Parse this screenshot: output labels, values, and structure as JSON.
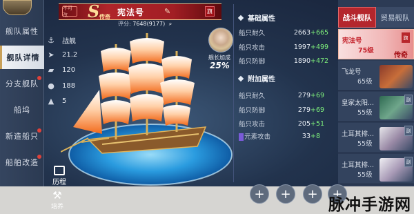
{
  "colors": {
    "accent_red": "#b4262c",
    "bonus_green": "#7ef07c",
    "bg_dark": "#1f2d45"
  },
  "nav": {
    "items": [
      {
        "label": "舰队属性",
        "active": false,
        "dot": false
      },
      {
        "label": "舰队详情",
        "active": true,
        "dot": false
      },
      {
        "label": "分支舰队",
        "active": false,
        "dot": true
      },
      {
        "label": "船坞",
        "active": false,
        "dot": false
      },
      {
        "label": "新造船只",
        "active": false,
        "dot": true
      },
      {
        "label": "船舶改造",
        "active": false,
        "dot": true
      }
    ],
    "history_label": "历程"
  },
  "ship_stats": [
    {
      "icon": "warship-icon",
      "value": "战舰"
    },
    {
      "icon": "speed-icon",
      "value": "21.2"
    },
    {
      "icon": "cannon-icon",
      "value": "120"
    },
    {
      "icon": "crew-icon",
      "value": "188"
    },
    {
      "icon": "cargo-icon",
      "value": "5"
    }
  ],
  "ship": {
    "grade": "S",
    "grade_label": "传奇",
    "name": "宪法号",
    "rating_label": "评分:",
    "rating_value": "7648(9177)",
    "left_stamp": "不可改",
    "right_stamp": "旗"
  },
  "captain": {
    "label": "舰长加成",
    "bonus": "25%"
  },
  "base_attrs": {
    "title": "基础属性",
    "rows": [
      {
        "name": "船只耐久",
        "base": "2663",
        "bonus": "+665"
      },
      {
        "name": "船只攻击",
        "base": "1997",
        "bonus": "+499"
      },
      {
        "name": "船只防御",
        "base": "1890",
        "bonus": "+472"
      }
    ]
  },
  "extra_attrs": {
    "title": "附加属性",
    "rows": [
      {
        "name": "船只耐久",
        "base": "279",
        "bonus": "+69"
      },
      {
        "name": "船只防御",
        "base": "279",
        "bonus": "+69"
      },
      {
        "name": "船只攻击",
        "base": "205",
        "bonus": "+51"
      },
      {
        "name": "元素攻击",
        "base": "33",
        "bonus": "+8"
      }
    ]
  },
  "slots": [
    "+",
    "+",
    "+",
    "+"
  ],
  "fleet_tabs": [
    {
      "label": "战斗舰队",
      "active": true
    },
    {
      "label": "贸易舰队",
      "active": false
    }
  ],
  "fleet_cards": [
    {
      "name": "宪法号",
      "level": "75级",
      "tag": "旗",
      "legend": "传奇",
      "active": true
    },
    {
      "name": "飞龙号",
      "level": "65级",
      "active": false
    },
    {
      "name": "皇家太阳...",
      "level": "55级",
      "tag": "副",
      "active": false
    },
    {
      "name": "土耳其排...",
      "level": "55级",
      "tag": "副",
      "active": false
    },
    {
      "name": "土耳其排...",
      "level": "55级",
      "tag": "副",
      "active": false
    }
  ],
  "bottom": {
    "train_label": "培养",
    "watermark": "脉冲手游网"
  }
}
